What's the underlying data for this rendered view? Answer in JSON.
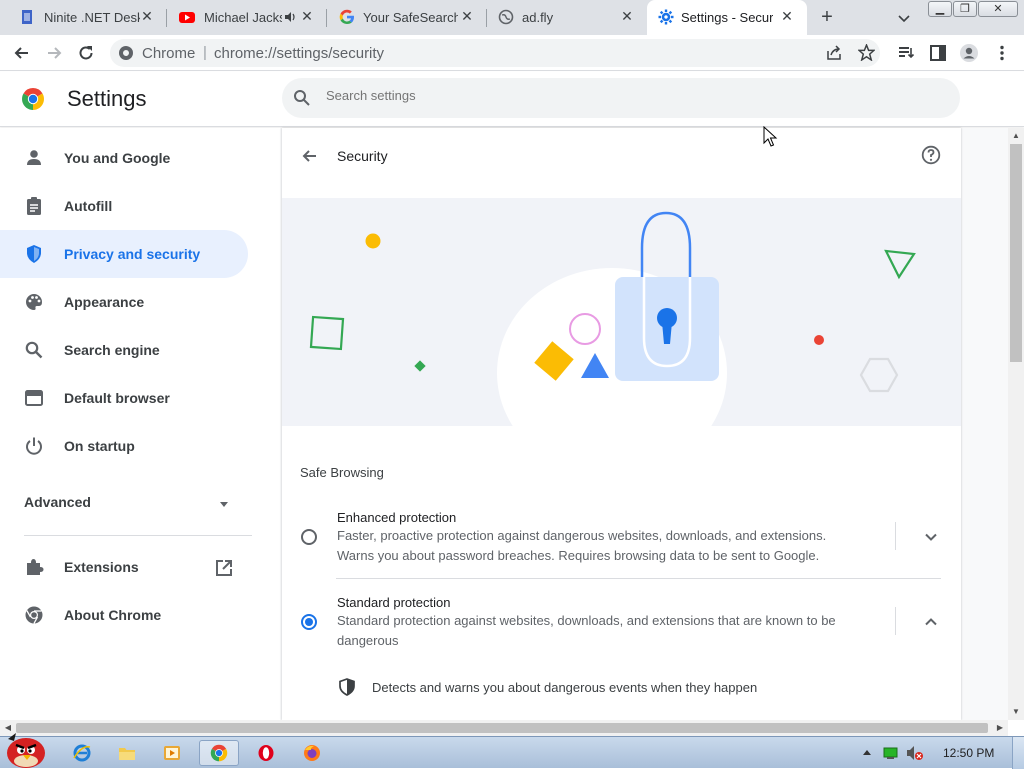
{
  "tabs": [
    {
      "title": "Ninite .NET Desktop",
      "icon": "ninite-icon",
      "active": false
    },
    {
      "title": "Michael Jackson",
      "icon": "youtube-icon",
      "active": false
    },
    {
      "title": "Your SafeSearch",
      "icon": "google-icon",
      "active": false
    },
    {
      "title": "ad.fly",
      "icon": "globe-icon",
      "active": false
    },
    {
      "title": "Settings - Security",
      "icon": "settings-gear-icon",
      "active": true
    }
  ],
  "toolbar": {
    "site_label": "Chrome",
    "divider": "|",
    "url": "chrome://settings/security"
  },
  "header": {
    "title": "Settings",
    "search_placeholder": "Search settings"
  },
  "sidebar": {
    "items": [
      {
        "label": "You and Google",
        "icon": "person-icon"
      },
      {
        "label": "Autofill",
        "icon": "clipboard-icon"
      },
      {
        "label": "Privacy and security",
        "icon": "shield-icon",
        "selected": true
      },
      {
        "label": "Appearance",
        "icon": "palette-icon"
      },
      {
        "label": "Search engine",
        "icon": "search-icon"
      },
      {
        "label": "Default browser",
        "icon": "browser-window-icon"
      },
      {
        "label": "On startup",
        "icon": "power-icon"
      }
    ],
    "advanced_label": "Advanced",
    "extensions_label": "Extensions",
    "about_label": "About Chrome"
  },
  "main": {
    "page_title": "Security",
    "section_title": "Safe Browsing",
    "options": [
      {
        "title": "Enhanced protection",
        "description": "Faster, proactive protection against dangerous websites, downloads, and extensions. Warns you about password breaches. Requires browsing data to be sent to Google.",
        "selected": false,
        "expanded": false
      },
      {
        "title": "Standard protection",
        "description": "Standard protection against websites, downloads, and extensions that are known to be dangerous",
        "selected": true,
        "expanded": true
      }
    ],
    "detail_text": "Detects and warns you about dangerous events when they happen"
  },
  "taskbar": {
    "clock": "12:50 PM",
    "apps": [
      "angry-birds-start-icon",
      "internet-explorer-icon",
      "folder-icon",
      "media-player-icon",
      "chrome-icon",
      "opera-icon",
      "firefox-icon"
    ]
  },
  "colors": {
    "accent": "#1a73e8",
    "selected_nav_bg": "#e8f0fe",
    "tabstrip_bg": "#dee1e6"
  }
}
